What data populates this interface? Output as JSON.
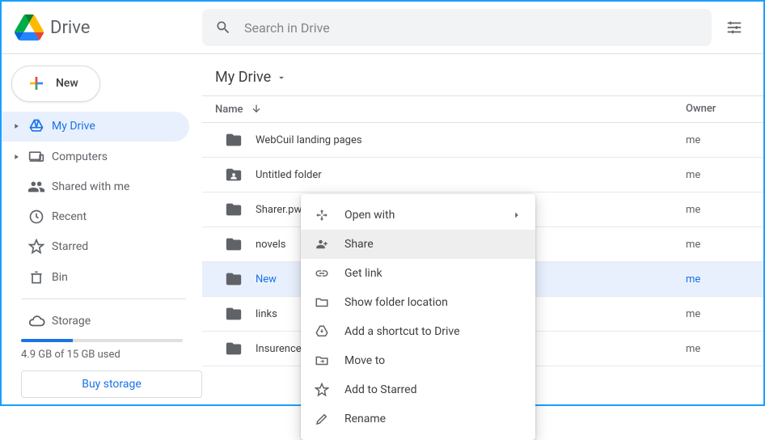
{
  "header": {
    "app_name": "Drive",
    "search_placeholder": "Search in Drive"
  },
  "sidebar": {
    "new_label": "New",
    "items": [
      {
        "label": "My Drive"
      },
      {
        "label": "Computers"
      },
      {
        "label": "Shared with me"
      },
      {
        "label": "Recent"
      },
      {
        "label": "Starred"
      },
      {
        "label": "Bin"
      }
    ],
    "storage_label": "Storage",
    "quota_text": "4.9 GB of 15 GB used",
    "buy_label": "Buy storage"
  },
  "breadcrumb": {
    "label": "My Drive"
  },
  "table": {
    "col_name": "Name",
    "col_owner": "Owner",
    "rows": [
      {
        "name": "WebCuil landing pages",
        "owner": "me",
        "type": "folder"
      },
      {
        "name": "Untitled folder",
        "owner": "me",
        "type": "shared-folder"
      },
      {
        "name": "Sharer.pw",
        "owner": "me",
        "type": "folder"
      },
      {
        "name": "novels",
        "owner": "me",
        "type": "folder"
      },
      {
        "name": "New",
        "owner": "me",
        "type": "folder"
      },
      {
        "name": "links",
        "owner": "me",
        "type": "folder"
      },
      {
        "name": "Insurence",
        "owner": "me",
        "type": "folder"
      }
    ]
  },
  "context_menu": {
    "items": [
      {
        "label": "Open with",
        "icon": "open-with",
        "submenu": true
      },
      {
        "label": "Share",
        "icon": "share"
      },
      {
        "label": "Get link",
        "icon": "link"
      },
      {
        "label": "Show folder location",
        "icon": "folder-outline"
      },
      {
        "label": "Add a shortcut to Drive",
        "icon": "shortcut"
      },
      {
        "label": "Move to",
        "icon": "move"
      },
      {
        "label": "Add to Starred",
        "icon": "star"
      },
      {
        "label": "Rename",
        "icon": "pencil"
      }
    ]
  }
}
